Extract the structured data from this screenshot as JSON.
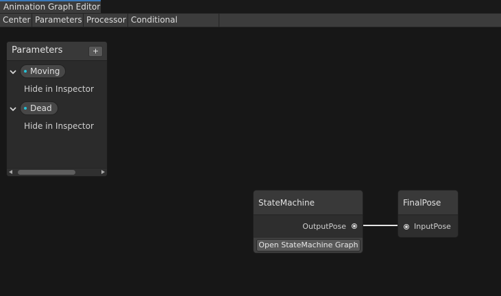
{
  "window": {
    "tab_title": "Animation Graph Editor"
  },
  "toolbar": {
    "buttons": [
      "Center",
      "Parameters",
      "Processor",
      "Conditional Processor"
    ]
  },
  "blackboard": {
    "title": "Parameters",
    "add_label": "+",
    "params": [
      {
        "name": "Moving",
        "option": "Hide in Inspector"
      },
      {
        "name": "Dead",
        "option": "Hide in Inspector"
      }
    ]
  },
  "nodes": {
    "state_machine": {
      "title": "StateMachine",
      "output_port": "OutputPose",
      "button": "Open StateMachine Graph"
    },
    "final_pose": {
      "title": "FinalPose",
      "input_port": "InputPose"
    }
  },
  "colors": {
    "param_dot": "#27c3d8",
    "tab_accent": "#3a79bb",
    "edge": "#e6e6e6"
  }
}
